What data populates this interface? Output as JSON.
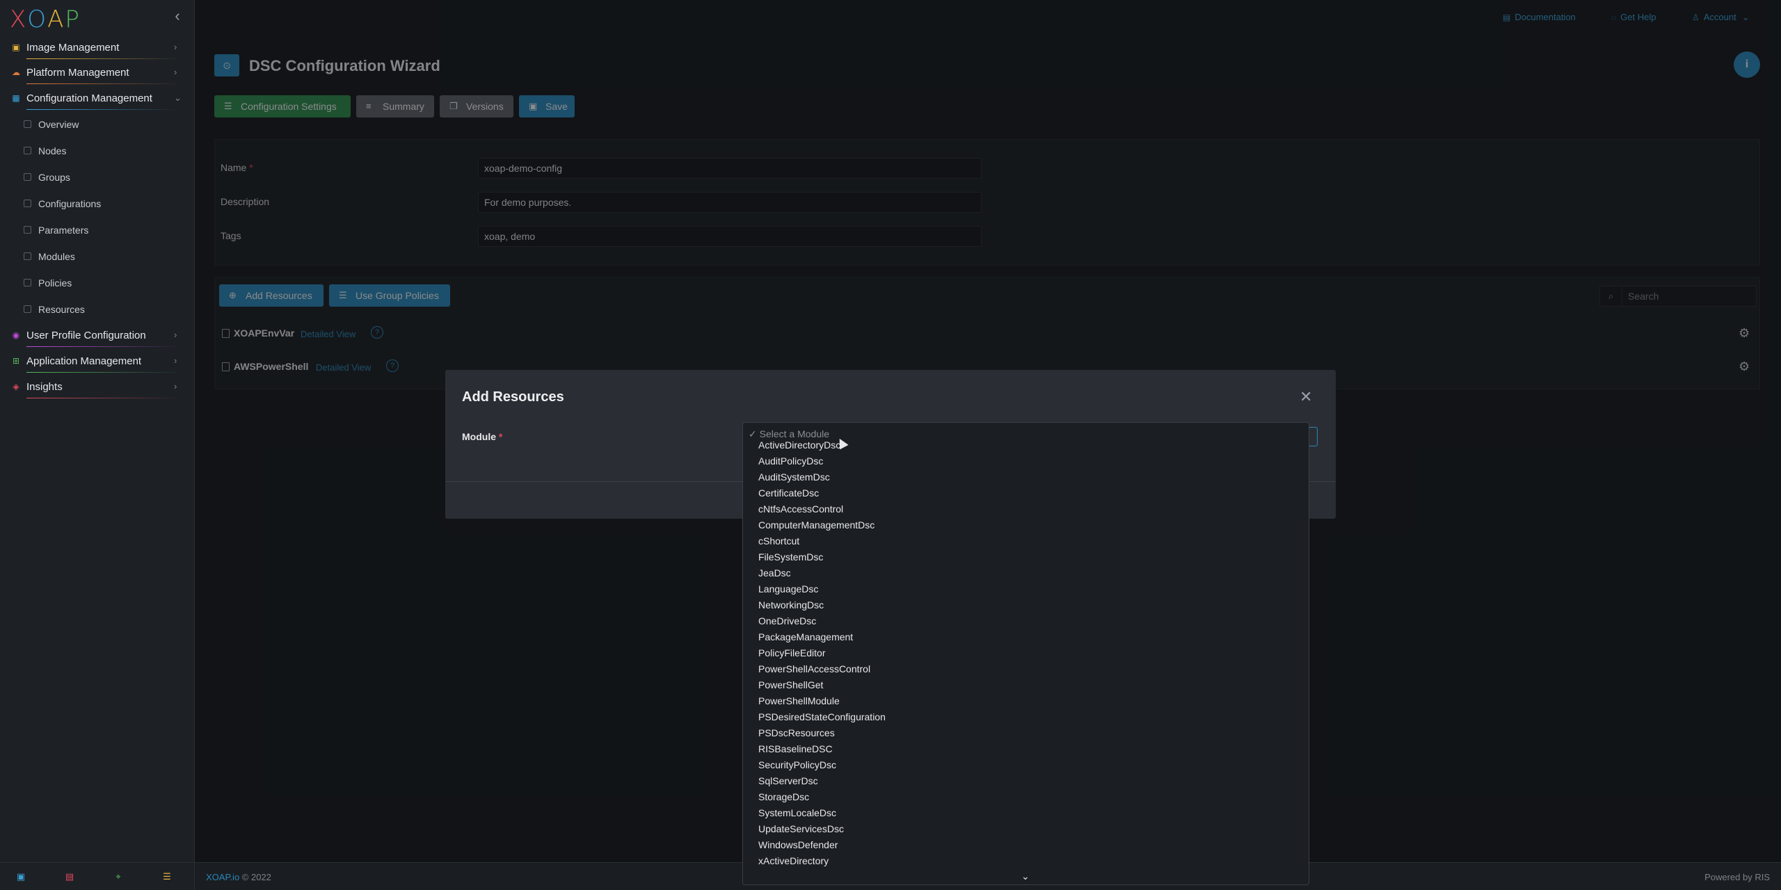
{
  "brand": {
    "logo_letters": [
      "X",
      "O",
      "A",
      "P"
    ],
    "logo_colors": [
      "#e0485a",
      "#3aa0d8",
      "#e6b23a",
      "#58b85c"
    ]
  },
  "sidebar": {
    "items": [
      {
        "label": "Image Management",
        "icon": "image-icon",
        "icon_glyph": "▣",
        "color": "#e6b23a",
        "expanded": false
      },
      {
        "label": "Platform Management",
        "icon": "platform-icon",
        "icon_glyph": "☁",
        "color": "#e07a3a",
        "expanded": false
      },
      {
        "label": "Configuration Management",
        "icon": "config-icon",
        "icon_glyph": "▦",
        "color": "#3aa0d8",
        "expanded": true
      },
      {
        "label": "User Profile Configuration",
        "icon": "user-profile-icon",
        "icon_glyph": "◉",
        "color": "#c04ad8",
        "expanded": false
      },
      {
        "label": "Application Management",
        "icon": "app-icon",
        "icon_glyph": "⊞",
        "color": "#58b85c",
        "expanded": false
      },
      {
        "label": "Insights",
        "icon": "insights-icon",
        "icon_glyph": "◈",
        "color": "#e0485a",
        "expanded": false
      }
    ],
    "subitems": [
      "Overview",
      "Nodes",
      "Groups",
      "Configurations",
      "Parameters",
      "Modules",
      "Policies",
      "Resources"
    ],
    "footer_icons": [
      {
        "name": "image-icon",
        "glyph": "▣",
        "color": "#3aa0d8"
      },
      {
        "name": "platform-icon",
        "glyph": "▤",
        "color": "#e0485a"
      },
      {
        "name": "location-icon",
        "glyph": "⌖",
        "color": "#58b85c"
      },
      {
        "name": "list-icon",
        "glyph": "☰",
        "color": "#e6b23a"
      }
    ]
  },
  "topbar": {
    "documentation": "Documentation",
    "get_help": "Get Help",
    "account": "Account"
  },
  "page": {
    "title": "DSC Configuration Wizard",
    "toolbar": {
      "configuration_settings": "Configuration Settings",
      "summary": "Summary",
      "versions": "Versions",
      "save": "Save"
    },
    "form": {
      "name_label": "Name",
      "name_value": "xoap-demo-config",
      "description_label": "Description",
      "description_value": "For demo purposes.",
      "tags_label": "Tags",
      "tags_value": "xoap, demo"
    },
    "resources": {
      "add_resources": "Add Resources",
      "use_group_policies": "Use Group Policies",
      "search_placeholder": "Search",
      "items": [
        {
          "name": "XOAPEnvVar",
          "link": "Detailed View"
        },
        {
          "name": "AWSPowerShell",
          "link": "Detailed View"
        }
      ]
    }
  },
  "modal": {
    "title": "Add Resources",
    "module_label": "Module",
    "dropdown": {
      "placeholder": "Select a Module",
      "options": [
        "ActiveDirectoryDsc",
        "AuditPolicyDsc",
        "AuditSystemDsc",
        "CertificateDsc",
        "cNtfsAccessControl",
        "ComputerManagementDsc",
        "cShortcut",
        "FileSystemDsc",
        "JeaDsc",
        "LanguageDsc",
        "NetworkingDsc",
        "OneDriveDsc",
        "PackageManagement",
        "PolicyFileEditor",
        "PowerShellAccessControl",
        "PowerShellGet",
        "PowerShellModule",
        "PSDesiredStateConfiguration",
        "PSDscResources",
        "RISBaselineDSC",
        "SecurityPolicyDsc",
        "SqlServerDsc",
        "StorageDsc",
        "SystemLocaleDsc",
        "UpdateServicesDsc",
        "WindowsDefender",
        "xActiveDirectory"
      ]
    }
  },
  "footer": {
    "link": "XOAP.io",
    "copyright": " © 2022",
    "powered": "Powered by RIS"
  }
}
